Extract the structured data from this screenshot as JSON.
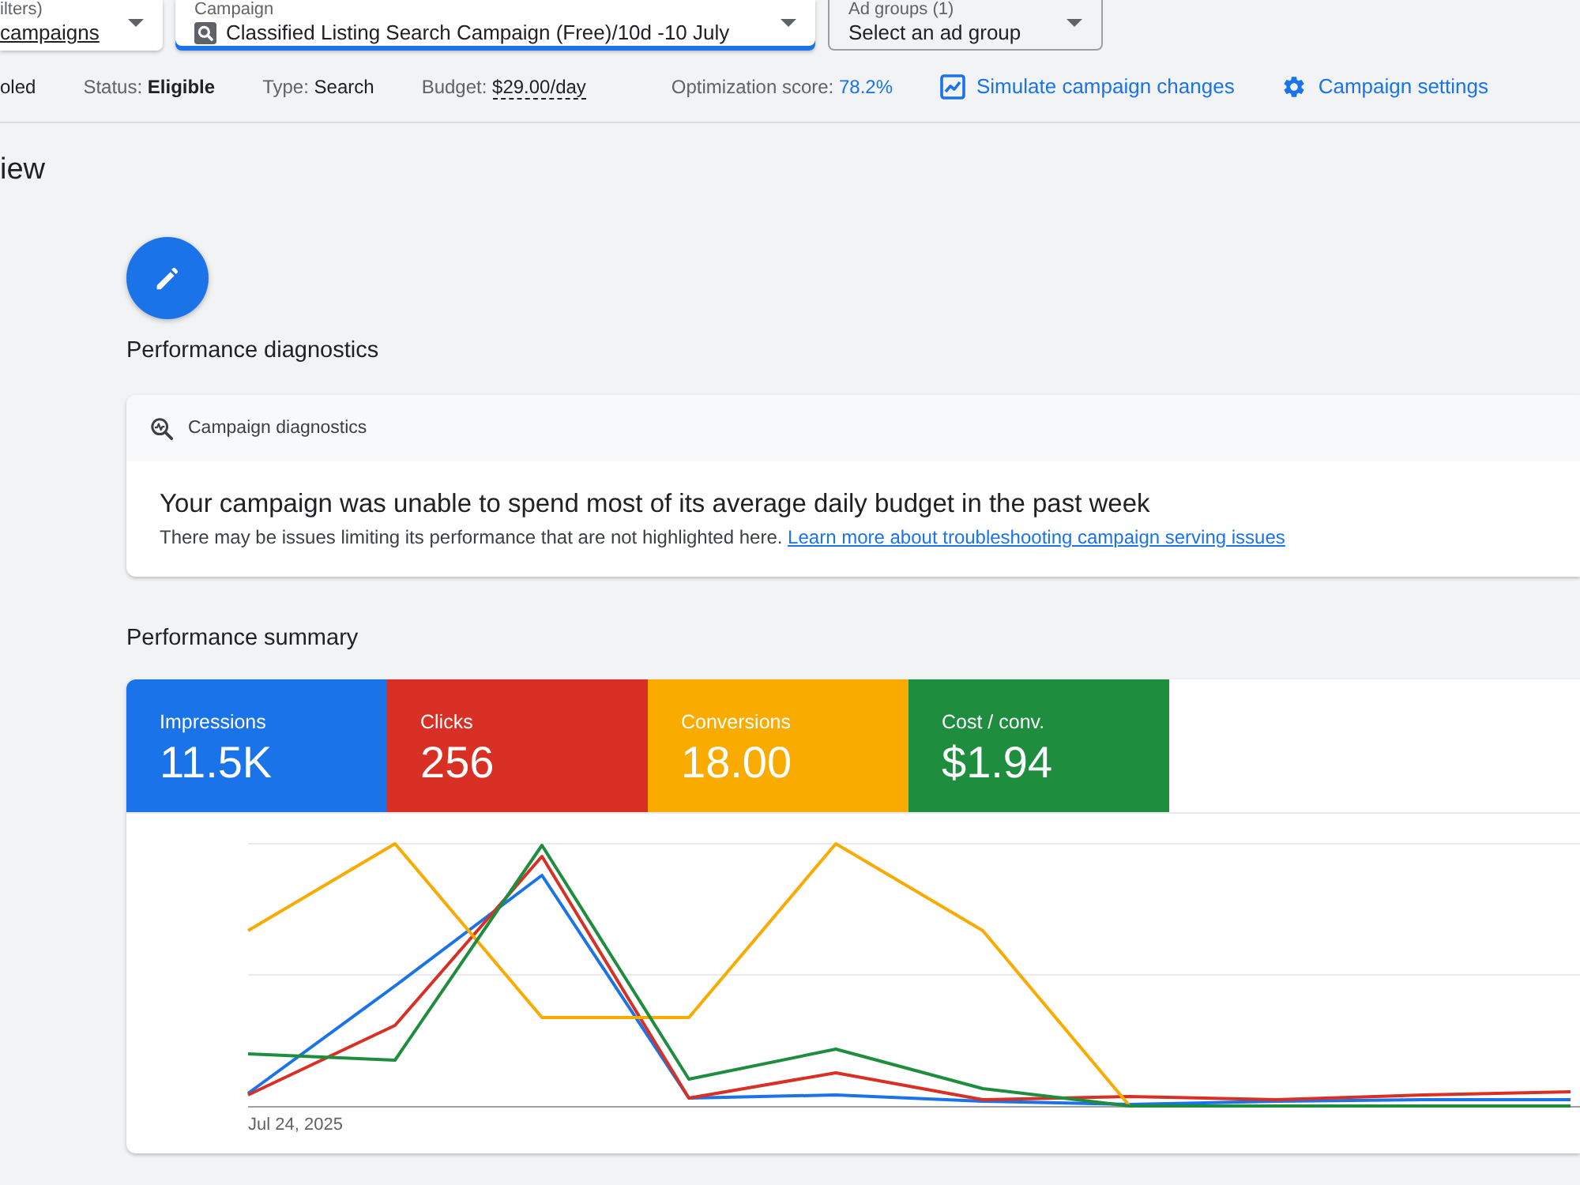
{
  "filters": [
    {
      "kind": "link",
      "label": "ilters)",
      "value": "campaigns",
      "focused": false
    },
    {
      "kind": "campaign",
      "label": "Campaign",
      "value": "Classified Listing Search Campaign (Free)/10d -10 July",
      "focused": true
    },
    {
      "kind": "outlined",
      "label": "Ad groups (1)",
      "value": "Select an ad group",
      "focused": false
    }
  ],
  "campaign_info": [
    {
      "kind": "state",
      "value": "oled"
    },
    {
      "kind": "status",
      "label": "Status:",
      "value": "Eligible"
    },
    {
      "kind": "type",
      "label": "Type:",
      "value": "Search"
    },
    {
      "kind": "budget",
      "label": "Budget:",
      "value": "$29.00/day"
    },
    {
      "kind": "score",
      "label": "Optimization score:",
      "value": "78.2%"
    }
  ],
  "actions": [
    {
      "kind": "chart",
      "label": "Simulate campaign changes"
    },
    {
      "kind": "settings",
      "label": "Campaign settings"
    }
  ],
  "page_title": "iew",
  "diagnostics": {
    "heading": "Performance diagnostics",
    "card_title": "Campaign diagnostics",
    "message": "Your campaign was unable to spend most of its average daily budget in the past week",
    "detail": "There may be issues limiting its performance that are not highlighted here.",
    "link": "Learn more about troubleshooting campaign serving issues"
  },
  "summary": {
    "heading": "Performance summary",
    "metrics": [
      {
        "label": "Impressions",
        "value": "11.5K",
        "color": "#1a73e8",
        "selected": true
      },
      {
        "label": "Clicks",
        "value": "256",
        "color": "#d93025",
        "selected": true
      },
      {
        "label": "Conversions",
        "value": "18.00",
        "color": "#f9ab00",
        "selected": true
      },
      {
        "label": "Cost / conv.",
        "value": "$1.94",
        "color": "#1e8e3e",
        "selected": true
      }
    ],
    "chart": {
      "start_label": "Jul 24, 2025"
    }
  }
}
